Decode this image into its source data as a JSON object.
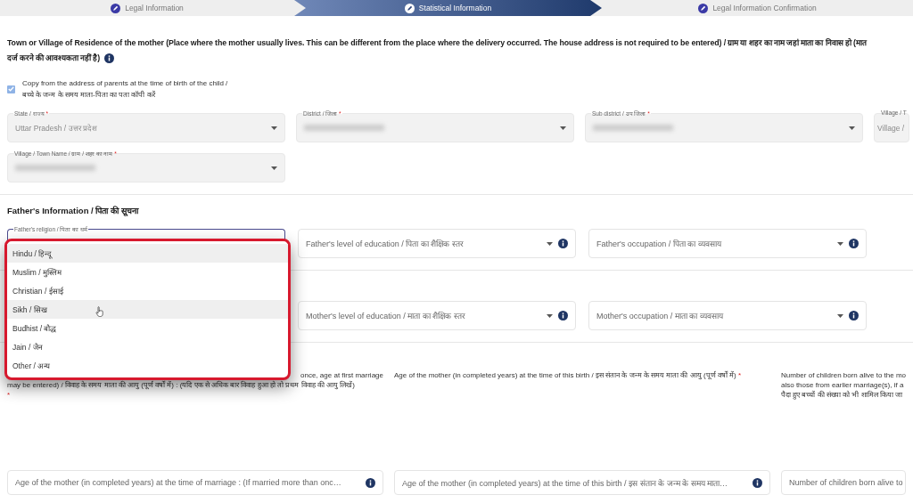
{
  "steps": [
    {
      "label": "Legal Information",
      "selected": false
    },
    {
      "label": "Statistical Information",
      "selected": true
    },
    {
      "label": "Legal Information Confirmation",
      "selected": false
    }
  ],
  "residence": {
    "heading_lines": [
      "Town or Village of Residence of the mother (Place where the mother usually lives. This can be different from the place where the delivery occurred. The house address is not required to be entered) / ग्राम या शहर का नाम जहां माता का निवास हो (मात",
      "दर्ज करने की आवश्यकता नहीं है)"
    ],
    "copy_address": {
      "label_lines": [
        "Copy from the address of parents at the time of birth of the child /",
        "बच्चे के जन्म के समय माता-पिता का पता कॉपी करें"
      ],
      "checked": true
    },
    "fields": [
      {
        "label": "State / राज्य",
        "required_mark": "*",
        "value": "Uttar Pradesh / उत्तर प्रदेश",
        "disabled": true
      },
      {
        "label": "District / जिला",
        "required_mark": "*",
        "blurred": true,
        "disabled": true
      },
      {
        "label": "Sub district / उप जिला",
        "required_mark": "*",
        "blurred": true,
        "disabled": true
      },
      {
        "label": "Village / T",
        "value": "Village /",
        "disabled": true
      },
      {
        "label": "Village / Town Name / ग्राम / शहर का नाम",
        "required_mark": "*",
        "blurred": true,
        "disabled": true
      }
    ]
  },
  "father": {
    "heading": "Father's Information / पिता की सूचना",
    "religion_label": "Father's religion / पिता का धर्म",
    "fields": [
      {
        "placeholder": "Father's level of education / पिता का शैक्षिक स्तर",
        "info": true
      },
      {
        "placeholder": "Father's occupation / पिता का व्यवसाय",
        "info": true
      }
    ]
  },
  "religion_menu": [
    {
      "label": "Hindu / हिन्दू",
      "highlighted": true
    },
    {
      "label": "Muslim / मुस्लिम",
      "highlighted": false
    },
    {
      "label": "Christian / ईसाई",
      "highlighted": false
    },
    {
      "label": "Sikh / सिख",
      "highlighted": true
    },
    {
      "label": "Budhist / बौद्ध",
      "highlighted": false
    },
    {
      "label": "Jain / जैन",
      "highlighted": false
    },
    {
      "label": "Other / अन्य",
      "highlighted": false
    }
  ],
  "mother": {
    "fields": [
      {
        "placeholder": "Mother's level of education / माता का शैक्षिक स्तर",
        "info": true
      },
      {
        "placeholder": "Mother's occupation / माता का व्यवसाय",
        "info": true
      }
    ]
  },
  "age_fields": [
    {
      "label_lines": [
        "once, age at first marriage",
        "may be entered) / विवाह के समय माता की आयु (पूर्ण वर्षों में) : (यदि एक से अधिक बार विवाह हुआ हो तो प्रथम विवाह की आयु लिखें)"
      ],
      "required_mark": "*",
      "placeholder": "Age of the mother (in completed years) at the time of marriage : (If married more than onc…",
      "info": true
    },
    {
      "label_lines": [
        "Age of the mother (in completed years) at the time of this birth / इस संतान के जन्म के समय माता की आयु (पूर्ण वर्षों में)"
      ],
      "required_mark": "*",
      "placeholder": "Age of the mother (in completed years) at the time of this birth / इस संतान के जन्म के समय माता…",
      "info": true
    },
    {
      "label_lines": [
        "Number of children born alive to the mo",
        "also those from earlier marriage(s), if a",
        "पैदा हुए बच्चों की संख्या को भी शामिल किया जा"
      ],
      "placeholder": "Number of children born alive to",
      "info": false
    }
  ]
}
